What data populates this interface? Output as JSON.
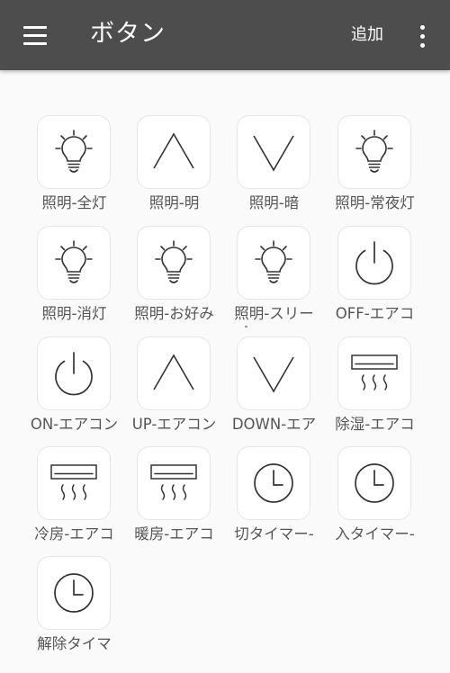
{
  "app_bar": {
    "title": "ボタン",
    "add_label": "追加",
    "menu_icon": "hamburger-menu-icon",
    "overflow_icon": "more-vertical-icon",
    "background": "#4d4d4d"
  },
  "buttons": [
    {
      "label": "照明-全灯",
      "icon": "lightbulb-icon"
    },
    {
      "label": "照明-明",
      "icon": "chevron-up-icon"
    },
    {
      "label": "照明-暗",
      "icon": "chevron-down-icon"
    },
    {
      "label": "照明-常夜灯",
      "icon": "lightbulb-icon"
    },
    {
      "label": "照明-消灯",
      "icon": "lightbulb-icon"
    },
    {
      "label": "照明-お好み",
      "icon": "lightbulb-icon"
    },
    {
      "label": "照明-スリー",
      "icon": "lightbulb-icon"
    },
    {
      "label": "OFF-エアコ",
      "icon": "power-icon"
    },
    {
      "label": "ON-エアコン",
      "icon": "power-icon"
    },
    {
      "label": "UP-エアコン",
      "icon": "chevron-up-icon"
    },
    {
      "label": "DOWN-エア",
      "icon": "chevron-down-icon"
    },
    {
      "label": "除湿-エアコ",
      "icon": "air-conditioner-icon"
    },
    {
      "label": "冷房-エアコ",
      "icon": "air-conditioner-icon"
    },
    {
      "label": "暖房-エアコ",
      "icon": "air-conditioner-icon"
    },
    {
      "label": "切タイマー-",
      "icon": "clock-icon"
    },
    {
      "label": "入タイマー-",
      "icon": "clock-icon"
    },
    {
      "label": "解除タイマ",
      "icon": "clock-icon"
    }
  ]
}
